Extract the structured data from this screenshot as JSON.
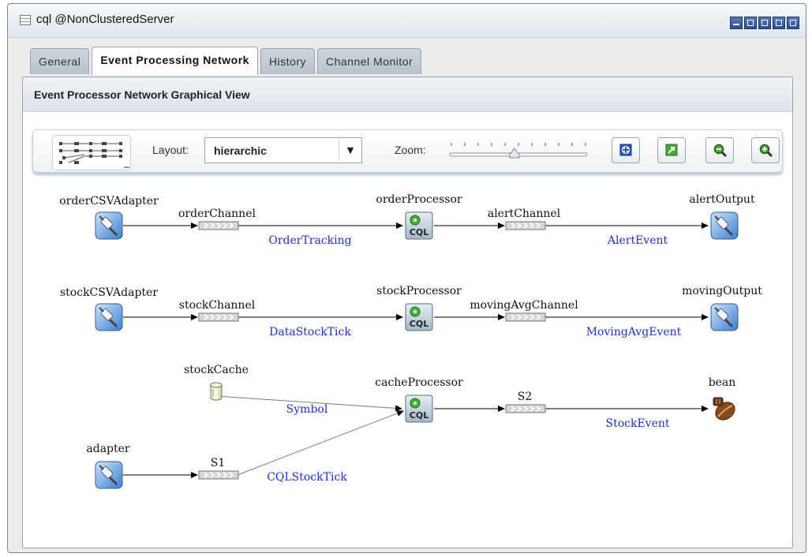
{
  "window": {
    "title": "cql @NonClusteredServer"
  },
  "tabs": [
    {
      "label": "General"
    },
    {
      "label": "Event Processing Network"
    },
    {
      "label": "History"
    },
    {
      "label": "Channel Monitor"
    }
  ],
  "panel": {
    "title": "Event Processor Network Graphical View"
  },
  "toolbar": {
    "layout_label": "Layout:",
    "layout_value": "hierarchic",
    "zoom_label": "Zoom:",
    "zoom_level": 0.47
  },
  "network": {
    "nodes": [
      {
        "label": "orderCSVAdapter",
        "kind": "adapter"
      },
      {
        "label": "orderChannel",
        "kind": "channel"
      },
      {
        "label": "orderProcessor",
        "kind": "processor"
      },
      {
        "label": "alertChannel",
        "kind": "channel"
      },
      {
        "label": "alertOutput",
        "kind": "adapter"
      },
      {
        "label": "stockCSVAdapter",
        "kind": "adapter"
      },
      {
        "label": "stockChannel",
        "kind": "channel"
      },
      {
        "label": "stockProcessor",
        "kind": "processor"
      },
      {
        "label": "movingAvgChannel",
        "kind": "channel"
      },
      {
        "label": "movingOutput",
        "kind": "adapter"
      },
      {
        "label": "stockCache",
        "kind": "cache"
      },
      {
        "label": "cacheProcessor",
        "kind": "processor"
      },
      {
        "label": "S2",
        "kind": "channel"
      },
      {
        "label": "bean",
        "kind": "bean"
      },
      {
        "label": "adapter",
        "kind": "adapter"
      },
      {
        "label": "S1",
        "kind": "channel"
      }
    ],
    "edge_labels": [
      "OrderTracking",
      "AlertEvent",
      "DataStockTick",
      "MovingAvgEvent",
      "Symbol",
      "StockEvent",
      "CQLStockTick"
    ]
  },
  "colors": {
    "edge_label": "#1f2fc8",
    "tab_bg": "#c3cbd4",
    "accent": "#2c4f8e"
  }
}
